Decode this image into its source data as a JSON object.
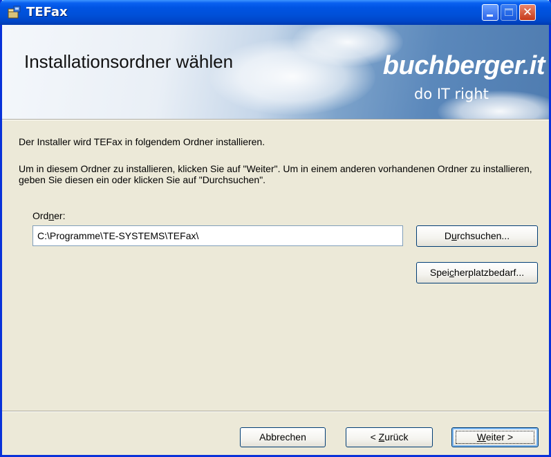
{
  "window": {
    "title": "TEFax",
    "accent_color": "#0054e3",
    "buttons": [
      "minimize-icon",
      "maximize-icon",
      "close-icon"
    ]
  },
  "banner": {
    "title": "Installationsordner wählen",
    "logo_main": "buchberger.it",
    "logo_sub": "do IT right"
  },
  "content": {
    "intro": "Der Installer wird TEFax in folgendem Ordner installieren.",
    "instruction": "Um in diesem Ordner zu installieren, klicken Sie auf \"Weiter\". Um in einem anderen vorhandenen Ordner zu installieren, geben Sie diesen ein oder klicken Sie auf \"Durchsuchen\".",
    "folder_label_pre": "Ord",
    "folder_label_ul": "n",
    "folder_label_post": "er:",
    "folder_value": "C:\\Programme\\TE-SYSTEMS\\TEFax\\"
  },
  "buttons": {
    "browse_pre": "D",
    "browse_ul": "u",
    "browse_post": "rchsuchen...",
    "disk_pre": "Spei",
    "disk_ul": "c",
    "disk_post": "herplatzbedarf...",
    "cancel": "Abbrechen",
    "back_pre": "< ",
    "back_ul": "Z",
    "back_post": "urück",
    "next_ul": "W",
    "next_post": "eiter >"
  }
}
